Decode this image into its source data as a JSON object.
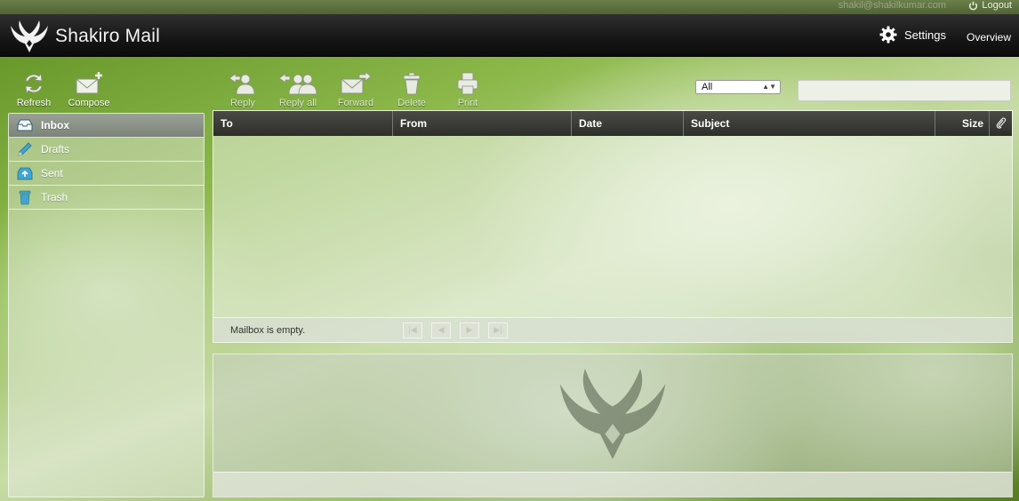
{
  "top_strip": {
    "user_email": "shakil@shakilkumar.com",
    "logout_label": "Logout"
  },
  "header": {
    "brand": "Shakiro Mail",
    "settings_label": "Settings",
    "overview_label": "Overview"
  },
  "toolbar": {
    "refresh": "Refresh",
    "compose": "Compose",
    "reply": "Reply",
    "reply_all": "Reply all",
    "forward": "Forward",
    "delete": "Delete",
    "print": "Print"
  },
  "filter": {
    "selected": "All"
  },
  "search": {
    "value": ""
  },
  "folders": [
    {
      "label": "Inbox",
      "icon": "inbox-icon",
      "active": true
    },
    {
      "label": "Drafts",
      "icon": "pencil-icon",
      "active": false
    },
    {
      "label": "Sent",
      "icon": "sent-icon",
      "active": false
    },
    {
      "label": "Trash",
      "icon": "trash-icon",
      "active": false
    }
  ],
  "message_list": {
    "columns": {
      "to": "To",
      "from": "From",
      "date": "Date",
      "subject": "Subject",
      "size": "Size"
    },
    "empty_message": "Mailbox is empty."
  },
  "colors": {
    "header_bg": "#161616",
    "column_header_bg": "#2d2d2a",
    "active_folder_bg": "#8a9187"
  }
}
